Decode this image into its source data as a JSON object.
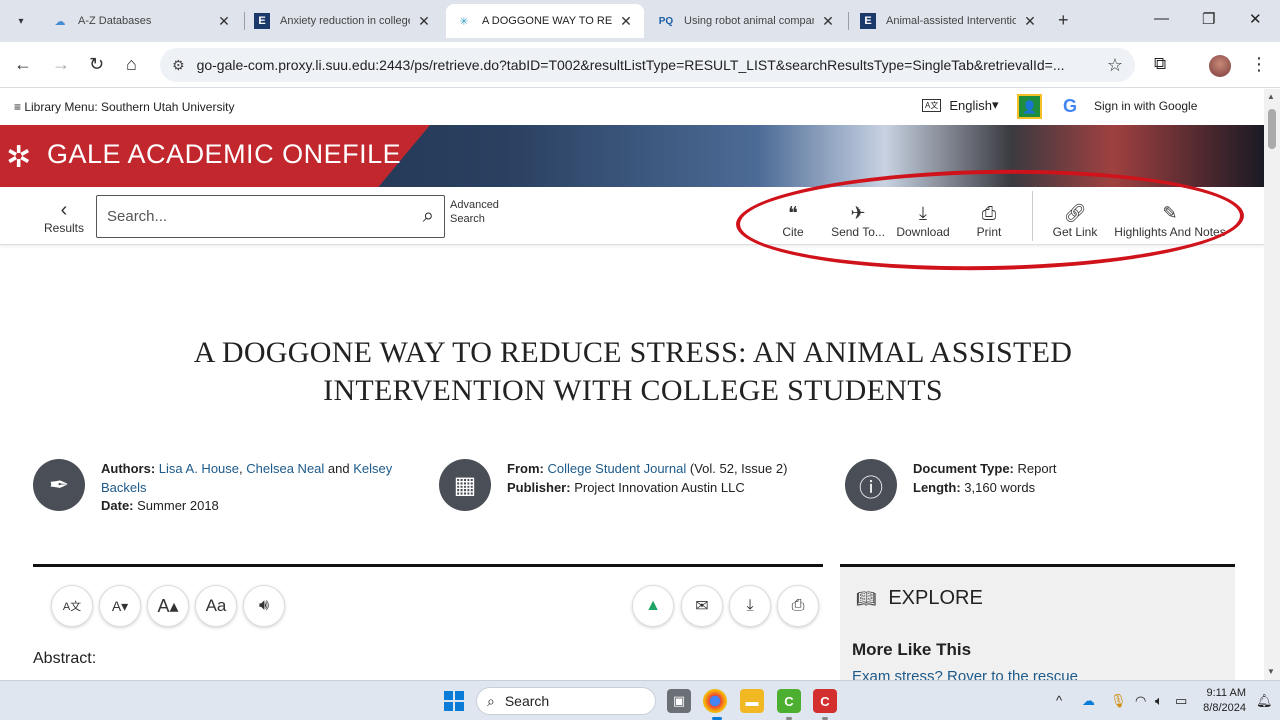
{
  "browser": {
    "tabs": [
      {
        "title": "A-Z Databases",
        "favicon": "database-favicon"
      },
      {
        "title": "Anxiety reduction in college",
        "favicon": "ebsco-favicon"
      },
      {
        "title": "A DOGGONE WAY TO REDU",
        "favicon": "gale-favicon"
      },
      {
        "title": "Using robot animal compan",
        "favicon": "proquest-favicon"
      },
      {
        "title": "Animal-assisted Interventio",
        "favicon": "ebsco-favicon"
      }
    ],
    "new_tab": "+",
    "url": "go-gale-com.proxy.li.suu.edu:2443/ps/retrieve.do?tabID=T002&resultListType=RESULT_LIST&searchResultsType=SingleTab&retrievalId=..."
  },
  "library_bar": {
    "menu": "Library Menu: Southern Utah University",
    "language": "English",
    "signin": "Sign in with Google"
  },
  "banner": {
    "title": "GALE ACADEMIC ONEFILE"
  },
  "toolbar": {
    "results": "Results",
    "search_placeholder": "Search...",
    "advanced_search_line1": "Advanced",
    "advanced_search_line2": "Search",
    "cite": "Cite",
    "send_to": "Send To...",
    "download": "Download",
    "print": "Print",
    "get_link": "Get Link",
    "highlights": "Highlights And Notes"
  },
  "article": {
    "title_line1": "A DOGGONE WAY TO REDUCE STRESS: AN ANIMAL ASSISTED",
    "title_line2": "INTERVENTION WITH COLLEGE STUDENTS",
    "authors_label": "Authors:",
    "author1": "Lisa A. House",
    "author2": "Chelsea Neal",
    "author_and": "and",
    "author3": "Kelsey Backels",
    "date_label": "Date:",
    "date": "Summer 2018",
    "from_label": "From:",
    "journal": "College Student Journal",
    "journal_issue": "(Vol. 52, Issue 2)",
    "publisher_label": "Publisher:",
    "publisher": "Project Innovation Austin LLC",
    "doctype_label": "Document Type:",
    "doctype": "Report",
    "length_label": "Length:",
    "length": "3,160 words",
    "abstract_label": "Abstract:"
  },
  "explore": {
    "heading": "EXPLORE",
    "more_like_this": "More Like This",
    "first_link": "Exam stress? Rover to the rescue"
  },
  "taskbar": {
    "search": "Search",
    "time": "9:11 AM",
    "date": "8/8/2024"
  },
  "colors": {
    "gale_red": "#c1272d",
    "link_blue": "#1d5a8a",
    "annotation_red": "#d0121b"
  }
}
